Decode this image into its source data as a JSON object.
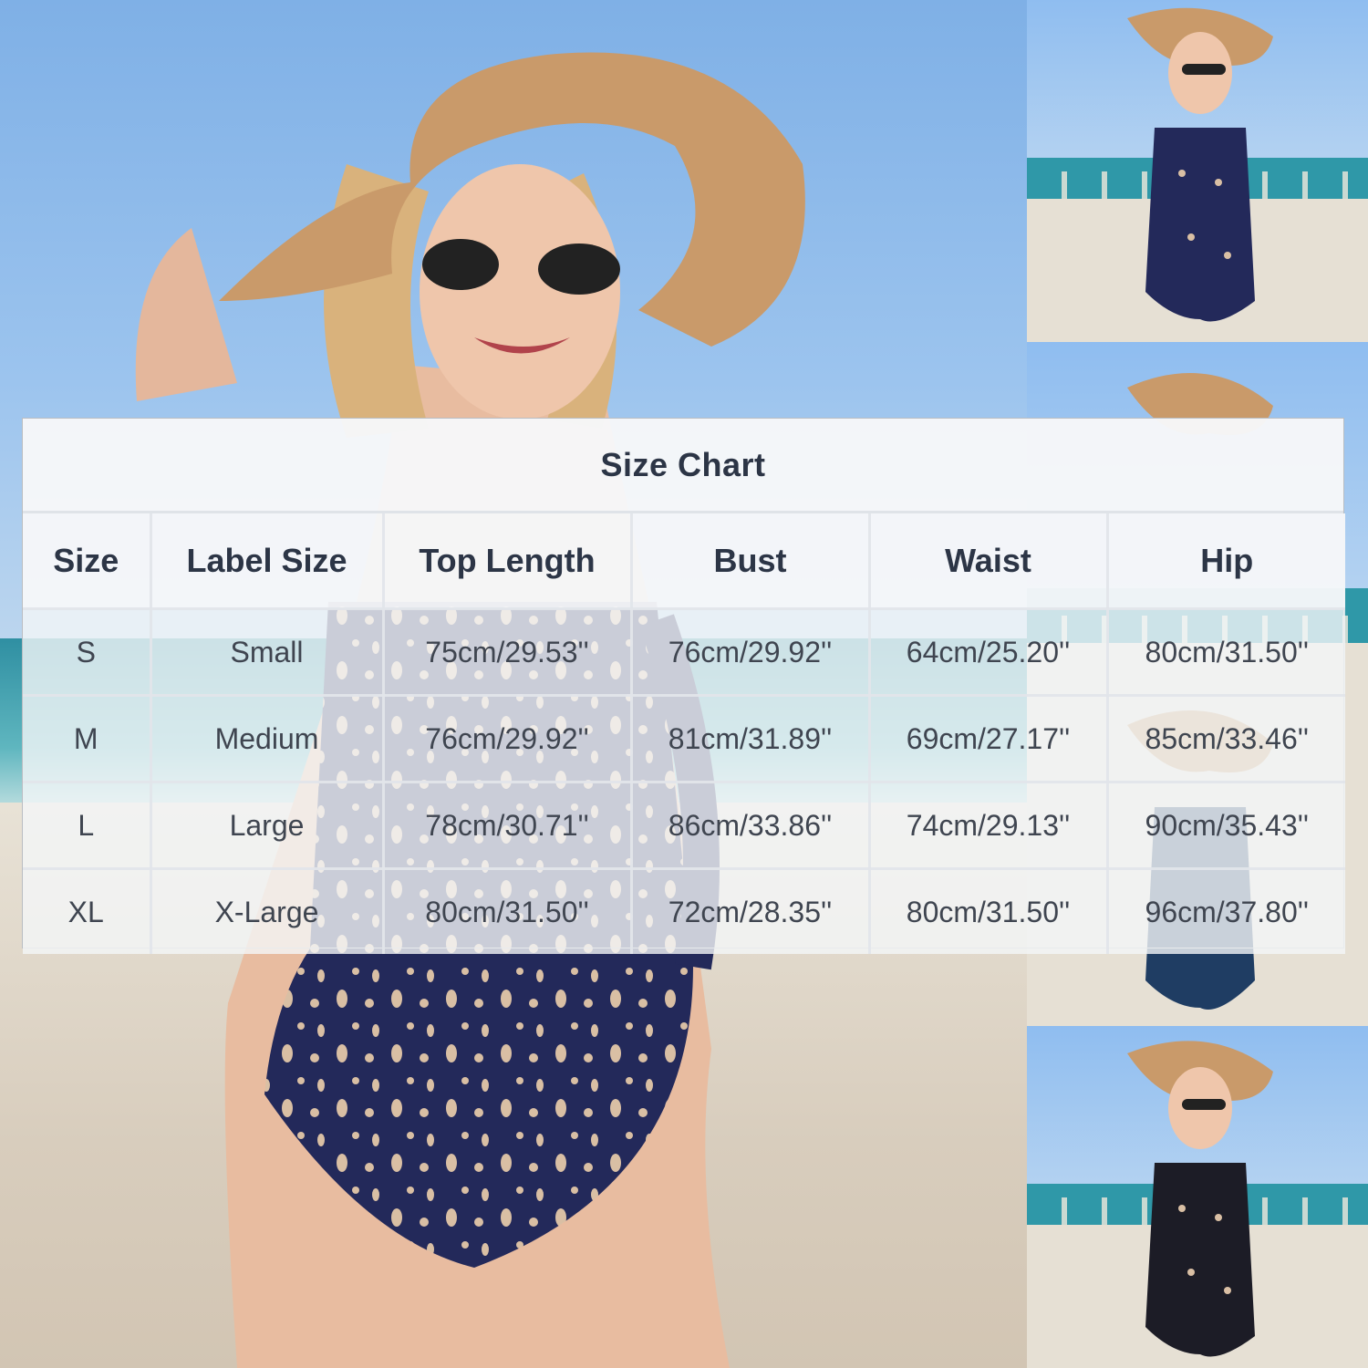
{
  "size_chart": {
    "title": "Size Chart",
    "columns": [
      "Size",
      "Label Size",
      "Top Length",
      "Bust",
      "Waist",
      "Hip"
    ],
    "rows": [
      [
        "S",
        "Small",
        "75cm/29.53''",
        "76cm/29.92''",
        "64cm/25.20''",
        "80cm/31.50''"
      ],
      [
        "M",
        "Medium",
        "76cm/29.92''",
        "81cm/31.89''",
        "69cm/27.17''",
        "85cm/33.46''"
      ],
      [
        "L",
        "Large",
        "78cm/30.71''",
        "86cm/33.86''",
        "74cm/29.13''",
        "90cm/35.43''"
      ],
      [
        "XL",
        "X-Large",
        "80cm/31.50''",
        "72cm/28.35''",
        "80cm/31.50''",
        "96cm/37.80''"
      ]
    ]
  },
  "colors": {
    "swimsuit": "#23295a",
    "pattern": "#d9bfa4",
    "hat": "#c99a6a",
    "header_text": "#2c3546"
  },
  "thumbnails": [
    {
      "swimsuit_color": "#23295a"
    },
    {
      "swimsuit_color": "#1f3d63"
    },
    {
      "swimsuit_color": "#1c1c26"
    }
  ]
}
